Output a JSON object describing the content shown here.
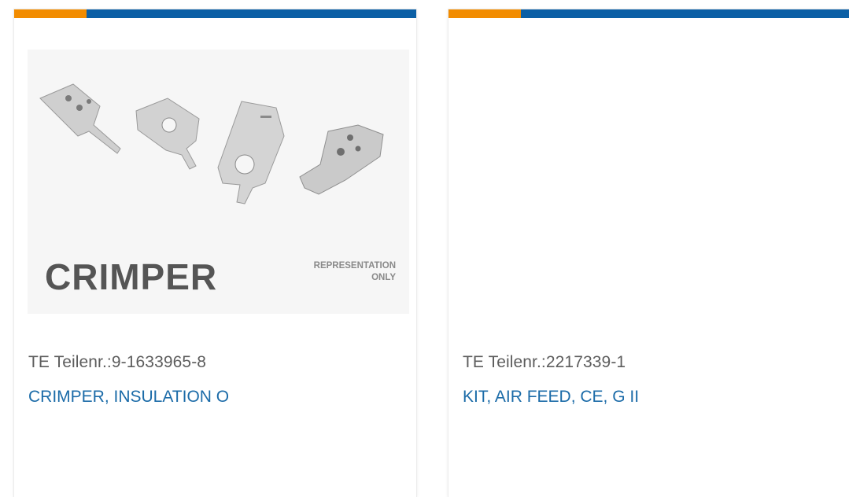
{
  "colors": {
    "accent_orange": "#f28c00",
    "accent_blue": "#0b5fa5",
    "link_blue": "#1b6ba8",
    "part_number_gray": "#5d5d5d"
  },
  "cards": [
    {
      "part_number": "TE Teilenr.:9-1633965-8",
      "description": "CRIMPER, INSULATION O",
      "image": {
        "brand_word": "CRIMPER",
        "note_line1": "REPRESENTATION",
        "note_line2": "ONLY"
      }
    },
    {
      "part_number": "TE Teilenr.:2217339-1",
      "description": "KIT, AIR FEED, CE, G II"
    }
  ]
}
